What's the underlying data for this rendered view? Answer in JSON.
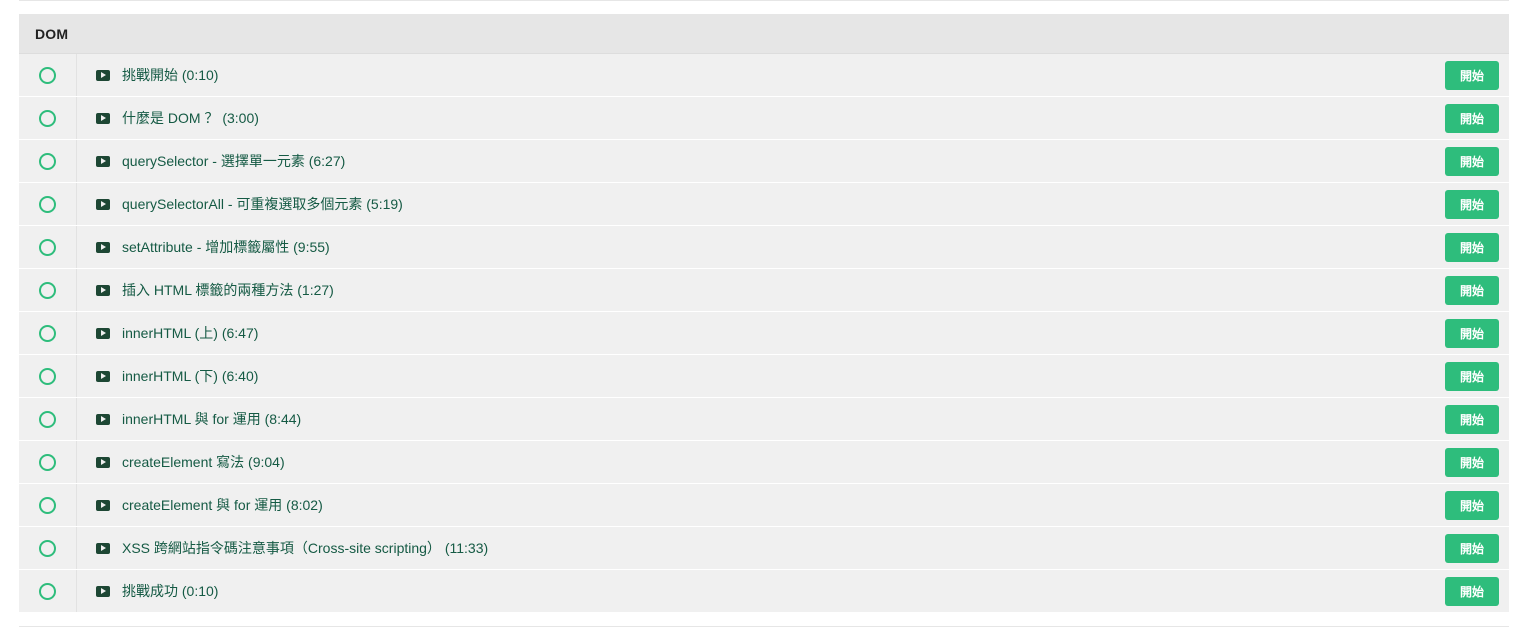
{
  "section": {
    "title": "DOM",
    "start_label": "開始",
    "lessons": [
      {
        "title": "挑戰開始 (0:10)"
      },
      {
        "title": "什麼是 DOM ？ (3:00)"
      },
      {
        "title": "querySelector - 選擇單一元素 (6:27)"
      },
      {
        "title": "querySelectorAll - 可重複選取多個元素 (5:19)"
      },
      {
        "title": "setAttribute - 增加標籤屬性 (9:55)"
      },
      {
        "title": "插入 HTML 標籤的兩種方法 (1:27)"
      },
      {
        "title": "innerHTML (上) (6:47)"
      },
      {
        "title": "innerHTML (下) (6:40)"
      },
      {
        "title": "innerHTML 與 for 運用 (8:44)"
      },
      {
        "title": "createElement 寫法 (9:04)"
      },
      {
        "title": "createElement 與 for 運用 (8:02)"
      },
      {
        "title": "XSS 跨網站指令碼注意事項（Cross-site scripting） (11:33)"
      },
      {
        "title": "挑戰成功 (0:10)"
      }
    ]
  },
  "colors": {
    "accent": "#2ebd7c",
    "row_background": "#f0f0f0",
    "header_background": "#e6e6e6",
    "title_text": "#155a44",
    "video_icon": "#1d4734"
  },
  "icons": {
    "status": "circle-outline-icon",
    "lesson_type": "video-play-icon"
  }
}
